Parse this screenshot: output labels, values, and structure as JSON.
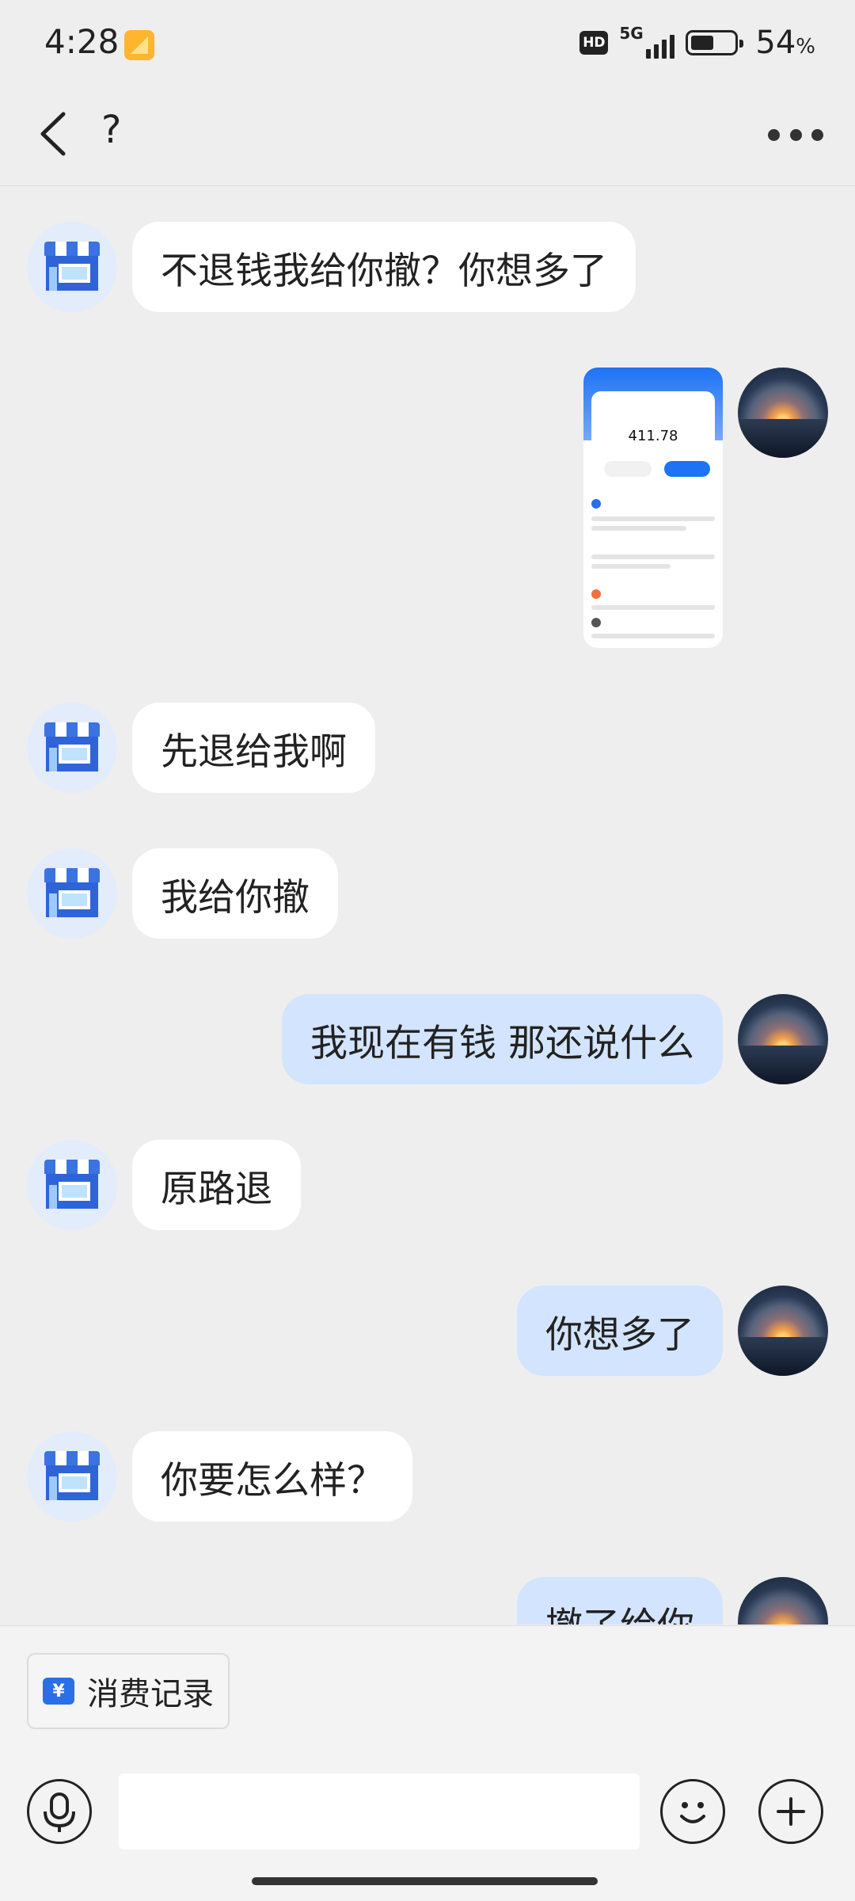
{
  "status_bar": {
    "time": "4:28",
    "hd_label": "HD",
    "network_label": "5G",
    "battery_percent": "54",
    "battery_unit": "%",
    "battery_level": 0.54,
    "app_icon": "gallery-app-icon"
  },
  "nav": {
    "title": "?",
    "back_icon": "chevron-left-icon",
    "more_icon": "more-dots-icon"
  },
  "messages": [
    {
      "side": "left",
      "type": "text",
      "text": "不退钱我给你撤？你想多了"
    },
    {
      "side": "right",
      "type": "image",
      "image": {
        "amount": "411.78"
      }
    },
    {
      "side": "left",
      "type": "text",
      "text": "先退给我啊"
    },
    {
      "side": "left",
      "type": "text",
      "text": "我给你撤"
    },
    {
      "side": "right",
      "type": "text",
      "text": "我现在有钱 那还说什么"
    },
    {
      "side": "left",
      "type": "text",
      "text": "原路退"
    },
    {
      "side": "right",
      "type": "text",
      "text": "你想多了"
    },
    {
      "side": "left",
      "type": "text",
      "text": "你要怎么样？"
    },
    {
      "side": "right",
      "type": "text",
      "text": "撤了给你"
    }
  ],
  "bottom": {
    "record_chip_label": "消费记录",
    "record_icon_glyph": "¥",
    "input_value": "",
    "input_placeholder": "",
    "icons": {
      "mic": "microphone-icon",
      "emoji": "smiley-icon",
      "plus": "plus-icon"
    }
  },
  "colors": {
    "background": "#eeeeee",
    "bubble_left": "#ffffff",
    "bubble_right": "#d3e4fe",
    "accent": "#2a6fe8"
  }
}
